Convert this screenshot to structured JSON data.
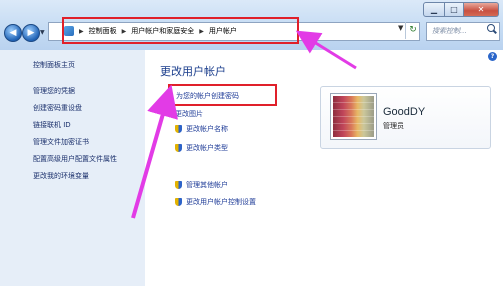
{
  "window": {
    "min_label": "▁",
    "max_label": "□",
    "close_label": "✕"
  },
  "address": {
    "crumbs": [
      "控制面板",
      "用户帐户和家庭安全",
      "用户帐户"
    ],
    "search_placeholder": "搜索控制..."
  },
  "sidebar": {
    "items": [
      "控制面板主页",
      "管理您的凭据",
      "创建密码重设盘",
      "链接联机 ID",
      "管理文件加密证书",
      "配置高级用户配置文件属性",
      "更改我的环境变量"
    ]
  },
  "main": {
    "title": "更改用户帐户",
    "tasks": [
      "为您的帐户创建密码",
      "更改图片",
      "更改帐户名称",
      "更改帐户类型"
    ],
    "other_tasks": [
      "管理其他帐户",
      "更改用户帐户控制设置"
    ]
  },
  "user": {
    "name": "GoodDY",
    "role": "管理员"
  },
  "colors": {
    "highlight_box": "#e0202a",
    "annotation_arrow": "#e23be6",
    "link": "#1e3b97"
  }
}
